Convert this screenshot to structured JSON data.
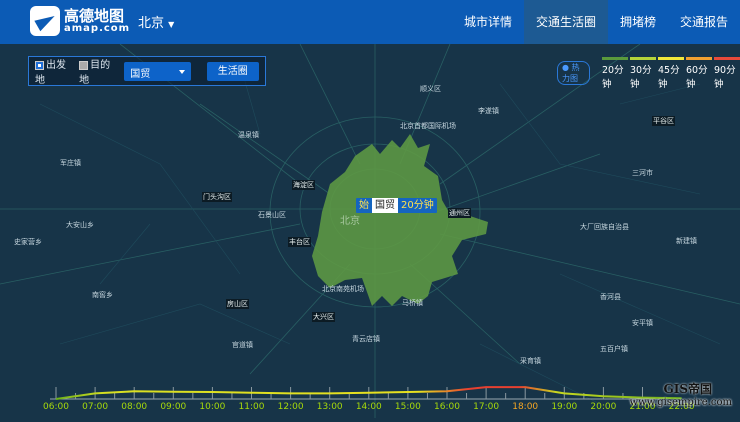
{
  "header": {
    "logo_cn": "高德地图",
    "logo_en": "amap.com",
    "city": "北京",
    "nav": [
      "城市详情",
      "交通生活圈",
      "拥堵榜",
      "交通报告"
    ],
    "active_nav": 1
  },
  "control": {
    "origin_label": "出发地",
    "destination_label": "目的地",
    "selected_place": "国贸",
    "button": "生活圈"
  },
  "legend": {
    "heatmap": "热力图",
    "items": [
      {
        "label": "20分钟",
        "color": "#5a9a3c"
      },
      {
        "label": "30分钟",
        "color": "#b5d43a"
      },
      {
        "label": "45分钟",
        "color": "#f0e83a"
      },
      {
        "label": "60分钟",
        "color": "#f0a030"
      },
      {
        "label": "90分钟",
        "color": "#e84a3a"
      }
    ]
  },
  "tooltip": {
    "prefix": "始",
    "place": "国贸",
    "time": "20分钟"
  },
  "map_labels": [
    "顺义区",
    "李遂镇",
    "北京首都国际机场",
    "温泉镇",
    "海淀区",
    "门头沟区",
    "石景山区",
    "丰台区",
    "北京",
    "大安山乡",
    "史家营乡",
    "南窖乡",
    "军庄镇",
    "北京南苑机场",
    "大兴区",
    "房山区",
    "马桥镇",
    "通州区",
    "三河市",
    "大厂回族自治县",
    "香河县",
    "平谷区",
    "安平镇",
    "五百户镇",
    "青云店镇",
    "采育镇",
    "新建镇",
    "官道镇"
  ],
  "timeline": {
    "hours": [
      "06:00",
      "07:00",
      "08:00",
      "09:00",
      "10:00",
      "11:00",
      "12:00",
      "13:00",
      "14:00",
      "15:00",
      "16:00",
      "17:00",
      "18:00",
      "19:00",
      "20:00",
      "21:00",
      "22:00"
    ],
    "selected": "18:00",
    "congestion": [
      1.0,
      1.4,
      1.55,
      1.52,
      1.5,
      1.45,
      1.4,
      1.4,
      1.45,
      1.5,
      1.55,
      1.85,
      1.85,
      1.4,
      1.2,
      1.1,
      1.05
    ]
  },
  "watermark": {
    "line1": "GIS帝国",
    "line2": "www.gisempire.com"
  }
}
